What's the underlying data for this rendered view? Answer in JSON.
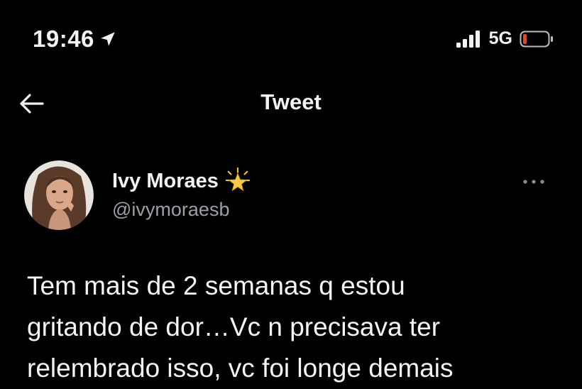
{
  "status_bar": {
    "time": "19:46",
    "network": "5G",
    "icons": [
      "location-arrow-icon",
      "signal-bars-icon",
      "battery-low-icon"
    ]
  },
  "header": {
    "title": "Tweet",
    "back_icon": "back-arrow-icon"
  },
  "tweet": {
    "author": {
      "name": "Ivy Moraes",
      "handle": "@ivymoraesb",
      "badge_icon": "star-emoji-icon",
      "avatar_icon": "profile-photo"
    },
    "more_icon": "more-options-icon",
    "text_lines": [
      "Tem mais de 2 semanas q estou",
      "gritando de dor…Vc n precisava ter",
      "relembrado isso, vc foi longe demais"
    ]
  },
  "colors": {
    "background": "#000000",
    "text": "#f2f2f2",
    "secondary_text": "#9aa0a6",
    "battery_low": "#ff3b30"
  }
}
